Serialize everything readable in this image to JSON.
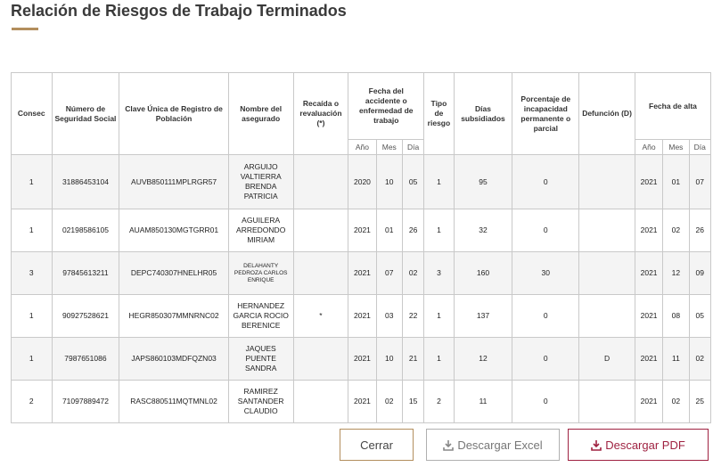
{
  "page": {
    "title": "Relación de Riesgos de Trabajo Terminados"
  },
  "table": {
    "headers": {
      "consec": "Consec",
      "nss": "Número de Seguridad Social",
      "curp": "Clave Única de Registro de Población",
      "nombre": "Nombre del asegurado",
      "recaida": "Recaída o revaluación (*)",
      "fecha_accidente": "Fecha del accidente o enfermedad de trabajo",
      "tipo": "Tipo de riesgo",
      "dias": "Días subsidiados",
      "porcentaje": "Porcentaje de incapacidad permanente o parcial",
      "defuncion": "Defunción (D)",
      "fecha_alta": "Fecha de alta",
      "anio": "Año",
      "mes": "Mes",
      "dia": "Día"
    },
    "rows": [
      {
        "consec": "1",
        "nss": "31886453104",
        "curp": "AUVB850111MPLRGR57",
        "nombre": "ARGUIJO VALTIERRA BRENDA PATRICIA",
        "recaida": "",
        "acc_anio": "2020",
        "acc_mes": "10",
        "acc_dia": "05",
        "tipo": "1",
        "dias": "95",
        "porcentaje": "0",
        "defuncion": "",
        "alta_anio": "2021",
        "alta_mes": "01",
        "alta_dia": "07"
      },
      {
        "consec": "1",
        "nss": "02198586105",
        "curp": "AUAM850130MGTGRR01",
        "nombre": "AGUILERA ARREDONDO MIRIAM",
        "recaida": "",
        "acc_anio": "2021",
        "acc_mes": "01",
        "acc_dia": "26",
        "tipo": "1",
        "dias": "32",
        "porcentaje": "0",
        "defuncion": "",
        "alta_anio": "2021",
        "alta_mes": "02",
        "alta_dia": "26"
      },
      {
        "consec": "3",
        "nss": "97845613211",
        "curp": "DEPC740307HNELHR05",
        "nombre": "DELAHANTY PEDROZA CARLOS ENRIQUE",
        "recaida": "",
        "acc_anio": "2021",
        "acc_mes": "07",
        "acc_dia": "02",
        "tipo": "3",
        "dias": "160",
        "porcentaje": "30",
        "defuncion": "",
        "alta_anio": "2021",
        "alta_mes": "12",
        "alta_dia": "09"
      },
      {
        "consec": "1",
        "nss": "90927528621",
        "curp": "HEGR850307MMNRNC02",
        "nombre": "HERNANDEZ GARCIA ROCIO BERENICE",
        "recaida": "*",
        "acc_anio": "2021",
        "acc_mes": "03",
        "acc_dia": "22",
        "tipo": "1",
        "dias": "137",
        "porcentaje": "0",
        "defuncion": "",
        "alta_anio": "2021",
        "alta_mes": "08",
        "alta_dia": "05"
      },
      {
        "consec": "1",
        "nss": "7987651086",
        "curp": "JAPS860103MDFQZN03",
        "nombre": "JAQUES PUENTE SANDRA",
        "recaida": "",
        "acc_anio": "2021",
        "acc_mes": "10",
        "acc_dia": "21",
        "tipo": "1",
        "dias": "12",
        "porcentaje": "0",
        "defuncion": "D",
        "alta_anio": "2021",
        "alta_mes": "11",
        "alta_dia": "02"
      },
      {
        "consec": "2",
        "nss": "71097889472",
        "curp": "RASC880511MQTMNL02",
        "nombre": "RAMIREZ SANTANDER CLAUDIO",
        "recaida": "",
        "acc_anio": "2021",
        "acc_mes": "02",
        "acc_dia": "15",
        "tipo": "2",
        "dias": "11",
        "porcentaje": "0",
        "defuncion": "",
        "alta_anio": "2021",
        "alta_mes": "02",
        "alta_dia": "25"
      }
    ]
  },
  "buttons": {
    "cerrar": "Cerrar",
    "excel": "Descargar Excel",
    "pdf": "Descargar PDF"
  },
  "icons": {
    "excel": "download-icon",
    "pdf": "download-icon"
  },
  "colors": {
    "accent_gold": "#b38e5d",
    "accent_red": "#9f2241",
    "border": "#c9c9c9"
  }
}
